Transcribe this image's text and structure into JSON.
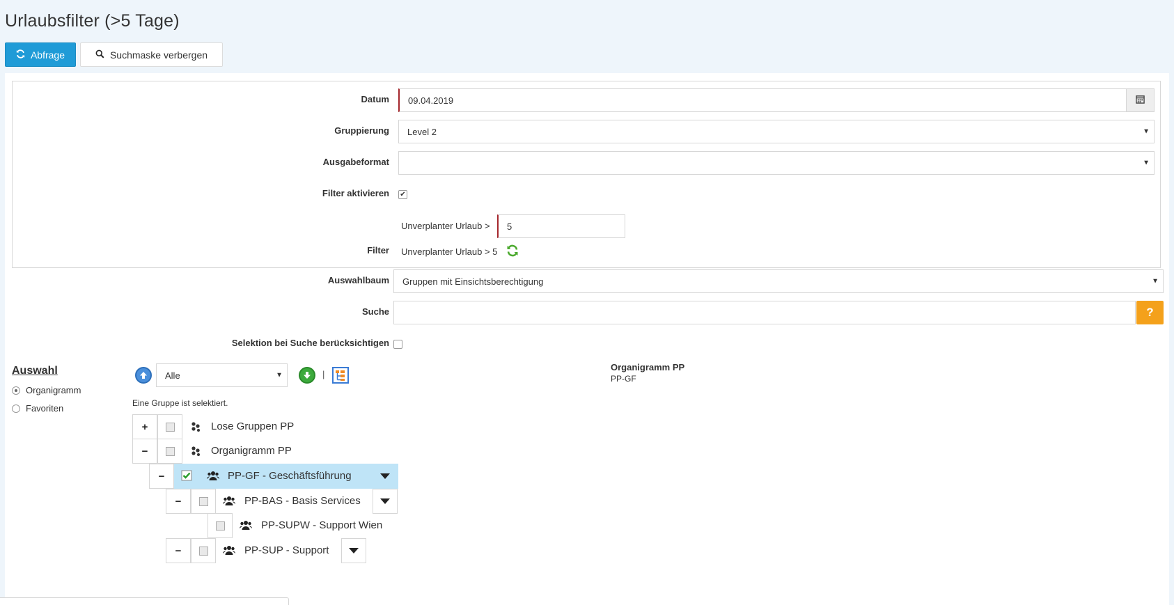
{
  "page": {
    "title": "Urlaubsfilter (>5 Tage)"
  },
  "toolbar": {
    "query_label": "Abfrage",
    "hide_search_label": "Suchmaske verbergen"
  },
  "filter_form": {
    "date": {
      "label": "Datum",
      "value": "09.04.2019"
    },
    "grouping": {
      "label": "Gruppierung",
      "value": "Level 2"
    },
    "output_format": {
      "label": "Ausgabeformat",
      "value": ""
    },
    "filter_active": {
      "label": "Filter aktivieren",
      "checked": true
    },
    "unplanned_vacation": {
      "label": "Unverplanter Urlaub >",
      "value": "5"
    },
    "filter": {
      "label": "Filter",
      "summary": "Unverplanter Urlaub > 5"
    }
  },
  "selection_form": {
    "tree": {
      "label": "Auswahlbaum",
      "value": "Gruppen mit Einsichtsberechtigung"
    },
    "search": {
      "label": "Suche",
      "value": "",
      "help": "?"
    },
    "consider_selection": {
      "label": "Selektion bei Suche berücksichtigen",
      "checked": false
    }
  },
  "auswahl": {
    "title": "Auswahl",
    "options": [
      {
        "label": "Organigramm",
        "selected": true
      },
      {
        "label": "Favoriten",
        "selected": false
      }
    ],
    "filter_select": "Alle",
    "separator": "|",
    "status": "Eine Gruppe ist selektiert.",
    "tree": [
      {
        "toggle": "+",
        "label": "Lose Gruppen PP",
        "icon": "group-stack-icon",
        "checked": false,
        "selected": false,
        "dropdown": false
      },
      {
        "toggle": "−",
        "label": "Organigramm PP",
        "icon": "group-stack-icon",
        "checked": false,
        "selected": false,
        "dropdown": false
      },
      {
        "toggle": "−",
        "label": "PP-GF - Geschäftsführung",
        "icon": "users-icon",
        "checked": true,
        "selected": true,
        "dropdown": true
      },
      {
        "toggle": "−",
        "label": "PP-BAS - Basis Services",
        "icon": "users-icon",
        "checked": false,
        "selected": false,
        "dropdown": true
      },
      {
        "toggle": "",
        "label": "PP-SUPW - Support Wien",
        "icon": "users-icon",
        "checked": false,
        "selected": false,
        "dropdown": false
      },
      {
        "toggle": "−",
        "label": "PP-SUP - Support",
        "icon": "users-icon",
        "checked": false,
        "selected": false,
        "dropdown": true
      }
    ]
  },
  "selection_summary": {
    "title": "Organigramm PP",
    "value": "PP-GF"
  },
  "colors": {
    "primary": "#1f9bd7",
    "help": "#f4a11b",
    "selected_row": "#bfe4f7",
    "required_border": "#a4262c"
  }
}
